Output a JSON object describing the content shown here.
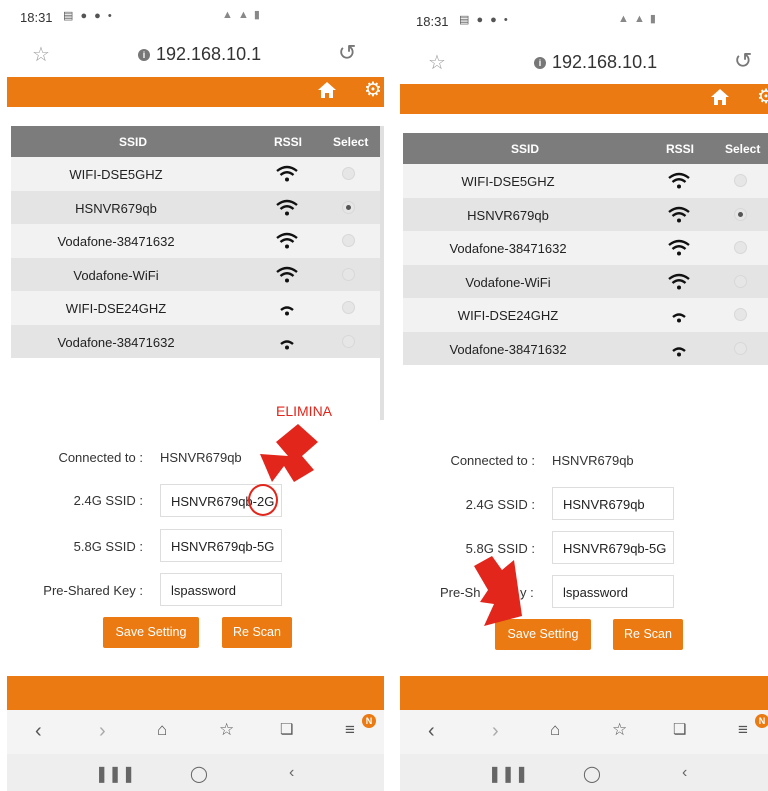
{
  "status_bar": {
    "time": "18:31",
    "dot": "•"
  },
  "browser": {
    "url": "192.168.10.1"
  },
  "table": {
    "headers": {
      "ssid": "SSID",
      "rssi": "RSSI",
      "select": "Select"
    },
    "rows": [
      {
        "ssid": "WIFI-DSE5GHZ",
        "signal": "full",
        "selected": false
      },
      {
        "ssid": "HSNVR679qb",
        "signal": "full",
        "selected": true
      },
      {
        "ssid": "Vodafone-38471632",
        "signal": "full",
        "selected": false
      },
      {
        "ssid": "Vodafone-WiFi",
        "signal": "full",
        "selected": false
      },
      {
        "ssid": "WIFI-DSE24GHZ",
        "signal": "low",
        "selected": false
      },
      {
        "ssid": "Vodafone-38471632",
        "signal": "low",
        "selected": false
      }
    ]
  },
  "form_left": {
    "connected_label": "Connected to :",
    "connected_value": "HSNVR679qb",
    "ssid24_label": "2.4G SSID :",
    "ssid24_value": "HSNVR679qb-2G",
    "ssid58_label": "5.8G SSID :",
    "ssid58_value": "HSNVR679qb-5G",
    "psk_label": "Pre-Shared Key :",
    "psk_value": "lspassword"
  },
  "form_right": {
    "connected_label": "Connected to :",
    "connected_value": "HSNVR679qb",
    "ssid24_label": "2.4G SSID :",
    "ssid24_value": "HSNVR679qb",
    "ssid58_label": "5.8G SSID :",
    "ssid58_value": "HSNVR679qb-5G",
    "psk_label_visible": "Pre-Sh",
    "psk_label_tail": "y :",
    "psk_value": "lspassword"
  },
  "buttons": {
    "save": "Save Setting",
    "rescan": "Re Scan"
  },
  "annotation": {
    "text": "ELIMINA"
  },
  "nav": {
    "badge": "N"
  },
  "colors": {
    "accent": "#ea7a11",
    "annotation": "#e2261b",
    "table_header": "#7c7c7c"
  },
  "icons": [
    "star-icon",
    "info-icon",
    "reload-icon",
    "home-icon",
    "gear-icon",
    "wifi-icon",
    "back-icon",
    "forward-icon",
    "home-nav-icon",
    "bookmarks-icon",
    "tabs-icon",
    "menu-icon",
    "recents-icon",
    "home-circle-icon",
    "back-arrow-icon"
  ]
}
